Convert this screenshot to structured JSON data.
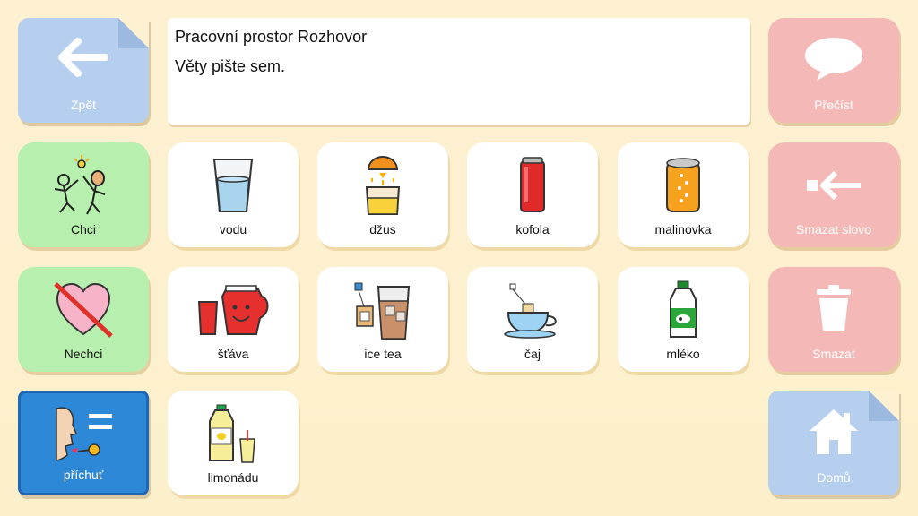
{
  "workspace": {
    "title": "Pracovní prostor Rozhovor",
    "placeholder": "Věty pište sem."
  },
  "nav": {
    "back_label": "Zpět",
    "home_label": "Domů"
  },
  "actions": {
    "read_label": "Přečíst",
    "delete_word_label": "Smazat slovo",
    "delete_label": "Smazat"
  },
  "categories": {
    "want_label": "Chci",
    "dont_want_label": "Nechci",
    "flavor_label": "příchuť"
  },
  "words": {
    "vodu": "vodu",
    "dzus": "džus",
    "kofola": "kofola",
    "malinovka": "malinovka",
    "stava": "šťáva",
    "ice_tea": "ice tea",
    "caj": "čaj",
    "mleko": "mléko",
    "limonadu": "limonádu"
  },
  "colors": {
    "background": "#fdf1d2",
    "nav_blue": "#b6cfee",
    "action_red": "#f4b9b7",
    "category_green": "#b7efae",
    "selected_blue": "#2e88d8"
  }
}
